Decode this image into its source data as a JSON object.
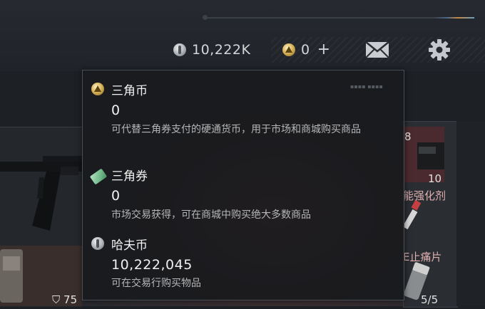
{
  "topbar": {
    "hafu_amount": "10,222K",
    "sanjiao_amount": "0",
    "add_label": "+"
  },
  "tooltip": {
    "sections": [
      {
        "title": "三角币",
        "amount": "0",
        "description": "可代替三角券支付的硬通货币，用于市场和商城购买商品",
        "icon": "triangle-coin-icon"
      },
      {
        "title": "三角券",
        "amount": "0",
        "description": "市场交易获得，可在商城中购买绝大多数商品",
        "icon": "triangle-ticket-icon"
      },
      {
        "title": "哈夫币",
        "amount": "10,222,045",
        "description": "可在交易行购买物品",
        "icon": "hafu-coin-icon"
      }
    ]
  },
  "background": {
    "slot_count_top": "8",
    "slot_count_mid": "10",
    "item_label_1": "能强化剂",
    "item_label_2": "E止痛片",
    "armor_value": "75",
    "capacity": "5/5"
  },
  "colors": {
    "background": "#1d2126",
    "tooltip_bg": "#16181c",
    "accent_gold": "#d9b45a",
    "accent_silver": "#b8bcc0",
    "accent_ticket": "#6fb98a"
  }
}
